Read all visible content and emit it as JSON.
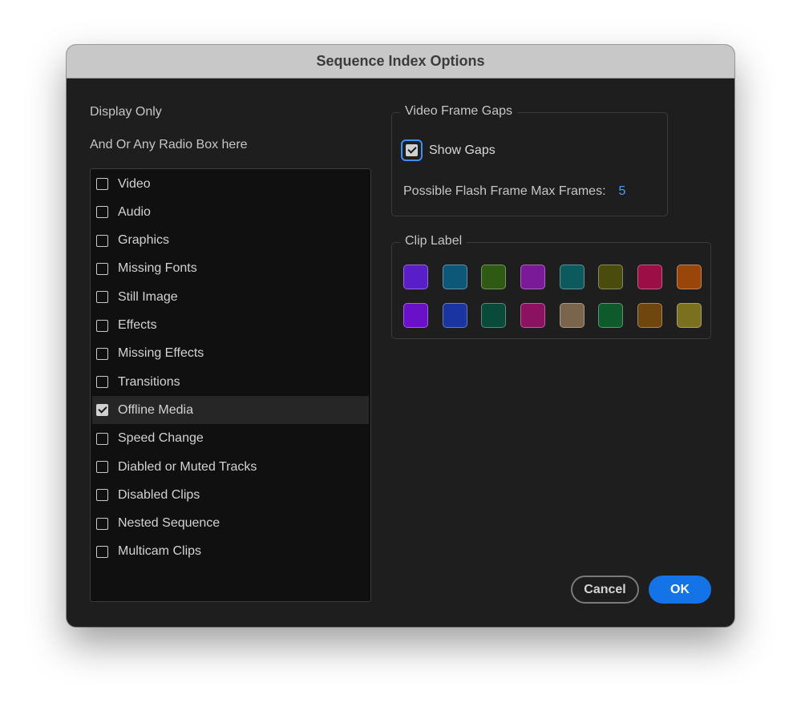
{
  "dialog": {
    "title": "Sequence Index Options"
  },
  "display": {
    "heading": "Display Only",
    "subheading": "And Or Any Radio Box here",
    "items": [
      {
        "label": "Video",
        "checked": false
      },
      {
        "label": "Audio",
        "checked": false
      },
      {
        "label": "Graphics",
        "checked": false
      },
      {
        "label": "Missing Fonts",
        "checked": false
      },
      {
        "label": "Still Image",
        "checked": false
      },
      {
        "label": "Effects",
        "checked": false
      },
      {
        "label": "Missing Effects",
        "checked": false
      },
      {
        "label": "Transitions",
        "checked": false
      },
      {
        "label": "Offline Media",
        "checked": true
      },
      {
        "label": "Speed Change",
        "checked": false
      },
      {
        "label": "Diabled or Muted Tracks",
        "checked": false
      },
      {
        "label": "Disabled Clips",
        "checked": false
      },
      {
        "label": "Nested Sequence",
        "checked": false
      },
      {
        "label": "Multicam Clips",
        "checked": false
      }
    ]
  },
  "video_frame_gaps": {
    "title": "Video Frame Gaps",
    "show_gaps_label": "Show Gaps",
    "show_gaps_checked": true,
    "flash_label": "Possible Flash Frame Max Frames:",
    "flash_value": "5"
  },
  "clip_label": {
    "title": "Clip Label",
    "colors": [
      "#5a1ec8",
      "#0d5878",
      "#2e5a14",
      "#7a1a98",
      "#0c5a5e",
      "#4a4c0e",
      "#9c0e46",
      "#9a460a",
      "#6a10c8",
      "#1a34a0",
      "#0a4a3a",
      "#8a1260",
      "#7a644c",
      "#0e5a2a",
      "#6e460e",
      "#7a7020"
    ]
  },
  "buttons": {
    "cancel": "Cancel",
    "ok": "OK"
  },
  "theme": {
    "accent": "#1473e6",
    "focus": "#3d8ef5",
    "value_text": "#4a9cf0"
  }
}
